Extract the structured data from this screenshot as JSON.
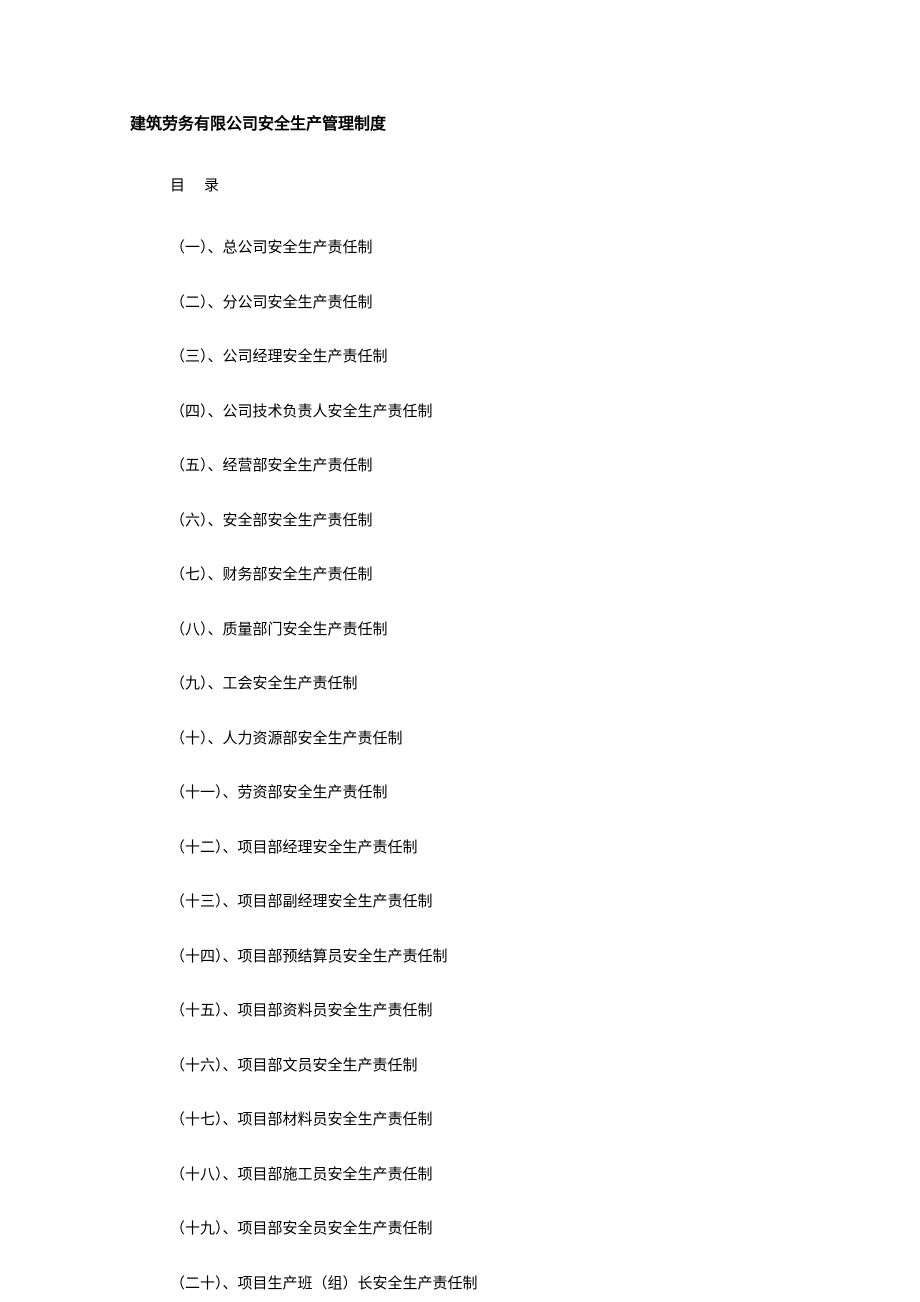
{
  "title": "建筑劳务有限公司安全生产管理制度",
  "tocHeader": "目　录",
  "items": [
    "（一）、总公司安全生产责任制",
    "（二）、分公司安全生产责任制",
    "（三）、公司经理安全生产责任制",
    "（四）、公司技术负责人安全生产责任制",
    "（五）、经营部安全生产责任制",
    "（六）、安全部安全生产责任制",
    "（七）、财务部安全生产责任制",
    "（八）、质量部门安全生产责任制",
    "（九）、工会安全生产责任制",
    "（十）、人力资源部安全生产责任制",
    "（十一）、劳资部安全生产责任制",
    "（十二）、项目部经理安全生产责任制",
    "（十三）、项目部副经理安全生产责任制",
    "（十四）、项目部预结算员安全生产责任制",
    "（十五）、项目部资料员安全生产责任制",
    "（十六）、项目部文员安全生产责任制",
    "（十七）、项目部材料员安全生产责任制",
    "（十八）、项目部施工员安全生产责任制",
    "（十九）、项目部安全员安全生产责任制",
    "（二十）、项目生产班（组）长安全生产责任制"
  ]
}
